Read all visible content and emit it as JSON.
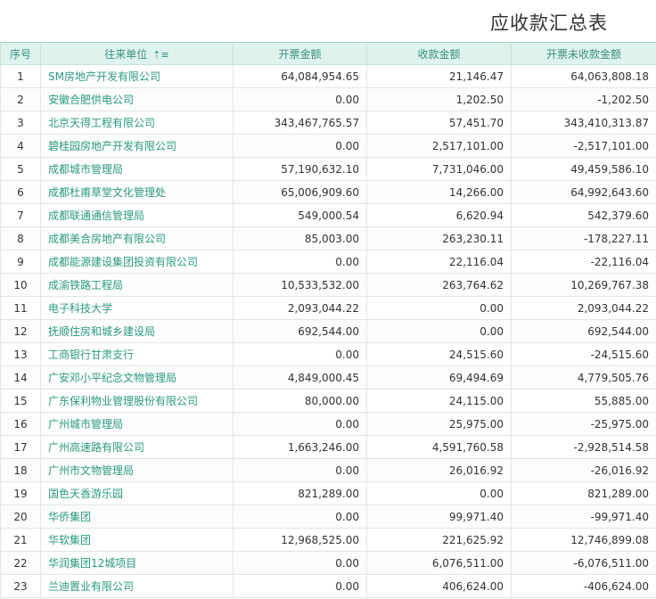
{
  "title": "应收款汇总表",
  "columns": {
    "index": "序号",
    "name": "往来单位",
    "invoiced": "开票金额",
    "received": "收款金额",
    "unreceived": "开票未收款金额"
  },
  "sort_icon": "sort-ascending-icon",
  "rows": [
    {
      "index": "1",
      "name": "SM房地产开发有限公司",
      "invoiced": "64,084,954.65",
      "received": "21,146.47",
      "unreceived": "64,063,808.18"
    },
    {
      "index": "2",
      "name": "安徽合肥供电公司",
      "invoiced": "0.00",
      "received": "1,202.50",
      "unreceived": "-1,202.50"
    },
    {
      "index": "3",
      "name": "北京天得工程有限公司",
      "invoiced": "343,467,765.57",
      "received": "57,451.70",
      "unreceived": "343,410,313.87"
    },
    {
      "index": "4",
      "name": "碧桂园房地产开发有限公司",
      "invoiced": "0.00",
      "received": "2,517,101.00",
      "unreceived": "-2,517,101.00"
    },
    {
      "index": "5",
      "name": "成都城市管理局",
      "invoiced": "57,190,632.10",
      "received": "7,731,046.00",
      "unreceived": "49,459,586.10"
    },
    {
      "index": "6",
      "name": "成都杜甫草堂文化管理处",
      "invoiced": "65,006,909.60",
      "received": "14,266.00",
      "unreceived": "64,992,643.60"
    },
    {
      "index": "7",
      "name": "成都联通通信管理局",
      "invoiced": "549,000.54",
      "received": "6,620.94",
      "unreceived": "542,379.60"
    },
    {
      "index": "8",
      "name": "成都美合房地产有限公司",
      "invoiced": "85,003.00",
      "received": "263,230.11",
      "unreceived": "-178,227.11"
    },
    {
      "index": "9",
      "name": "成都能源建设集团投资有限公司",
      "invoiced": "0.00",
      "received": "22,116.04",
      "unreceived": "-22,116.04"
    },
    {
      "index": "10",
      "name": "成渝铁路工程局",
      "invoiced": "10,533,532.00",
      "received": "263,764.62",
      "unreceived": "10,269,767.38"
    },
    {
      "index": "11",
      "name": "电子科技大学",
      "invoiced": "2,093,044.22",
      "received": "0.00",
      "unreceived": "2,093,044.22"
    },
    {
      "index": "12",
      "name": "抚顺住房和城乡建设局",
      "invoiced": "692,544.00",
      "received": "0.00",
      "unreceived": "692,544.00"
    },
    {
      "index": "13",
      "name": "工商银行甘肃支行",
      "invoiced": "0.00",
      "received": "24,515.60",
      "unreceived": "-24,515.60"
    },
    {
      "index": "14",
      "name": "广安邓小平纪念文物管理局",
      "invoiced": "4,849,000.45",
      "received": "69,494.69",
      "unreceived": "4,779,505.76"
    },
    {
      "index": "15",
      "name": "广东保利物业管理股份有限公司",
      "invoiced": "80,000.00",
      "received": "24,115.00",
      "unreceived": "55,885.00"
    },
    {
      "index": "16",
      "name": "广州城市管理局",
      "invoiced": "0.00",
      "received": "25,975.00",
      "unreceived": "-25,975.00"
    },
    {
      "index": "17",
      "name": "广州高速路有限公司",
      "invoiced": "1,663,246.00",
      "received": "4,591,760.58",
      "unreceived": "-2,928,514.58"
    },
    {
      "index": "18",
      "name": "广州市文物管理局",
      "invoiced": "0.00",
      "received": "26,016.92",
      "unreceived": "-26,016.92"
    },
    {
      "index": "19",
      "name": "国色天香游乐园",
      "invoiced": "821,289.00",
      "received": "0.00",
      "unreceived": "821,289.00"
    },
    {
      "index": "20",
      "name": "华侨集团",
      "invoiced": "0.00",
      "received": "99,971.40",
      "unreceived": "-99,971.40"
    },
    {
      "index": "21",
      "name": "华软集团",
      "invoiced": "12,968,525.00",
      "received": "221,625.92",
      "unreceived": "12,746,899.08"
    },
    {
      "index": "22",
      "name": "华润集团12城项目",
      "invoiced": "0.00",
      "received": "6,076,511.00",
      "unreceived": "-6,076,511.00"
    },
    {
      "index": "23",
      "name": "兰迪置业有限公司",
      "invoiced": "0.00",
      "received": "406,624.00",
      "unreceived": "-406,624.00"
    }
  ]
}
